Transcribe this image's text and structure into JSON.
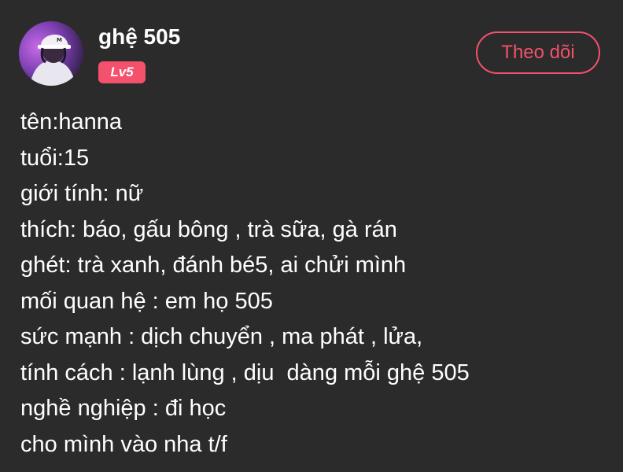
{
  "profile": {
    "username": "ghệ 505",
    "level_badge": "Lv5",
    "follow_label": "Theo dõi"
  },
  "bio_lines": [
    "tên:hanna",
    "tuổi:15",
    "giới tính: nữ",
    "thích: báo, gấu bông , trà sữa, gà rán",
    "ghét: trà xanh, đánh bé5, ai chửi mình",
    "mối quan hệ : em họ 505",
    "sức mạnh : dịch chuyển , ma phát , lửa,",
    "tính cách : lạnh lùng , dịu  dàng mỗi ghệ 505",
    "nghề nghiệp : đi học",
    "cho mình vào nha t/f"
  ],
  "colors": {
    "background": "#2b2b2b",
    "accent": "#f4516c",
    "text": "#ffffff"
  }
}
